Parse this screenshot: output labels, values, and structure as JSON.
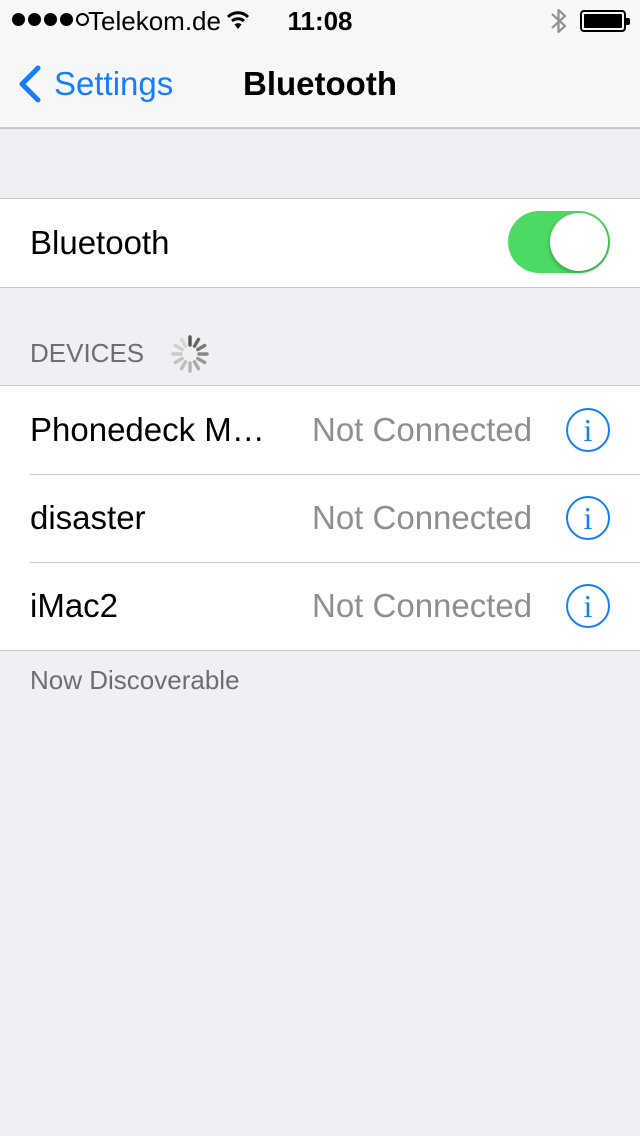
{
  "status_bar": {
    "carrier": "Telekom.de",
    "time": "11:08",
    "signal_bars_filled": 4,
    "signal_bars_total": 5,
    "wifi_icon": "wifi-icon",
    "bluetooth_icon": "bluetooth-icon",
    "battery_level": 1.0
  },
  "nav": {
    "back_label": "Settings",
    "title": "Bluetooth"
  },
  "bluetooth_toggle": {
    "label": "Bluetooth",
    "on": true
  },
  "devices": {
    "header": "DEVICES",
    "items": [
      {
        "name": "Phonedeck M…",
        "status": "Not Connected",
        "info_glyph": "i"
      },
      {
        "name": "disaster",
        "status": "Not Connected",
        "info_glyph": "i"
      },
      {
        "name": "iMac2",
        "status": "Not Connected",
        "info_glyph": "i"
      }
    ]
  },
  "footer": "Now Discoverable",
  "colors": {
    "accent": "#157efb",
    "toggle_on": "#4cd964",
    "background": "#efeff4",
    "secondary_text": "#8e8e93",
    "section_text": "#6d6d72"
  }
}
